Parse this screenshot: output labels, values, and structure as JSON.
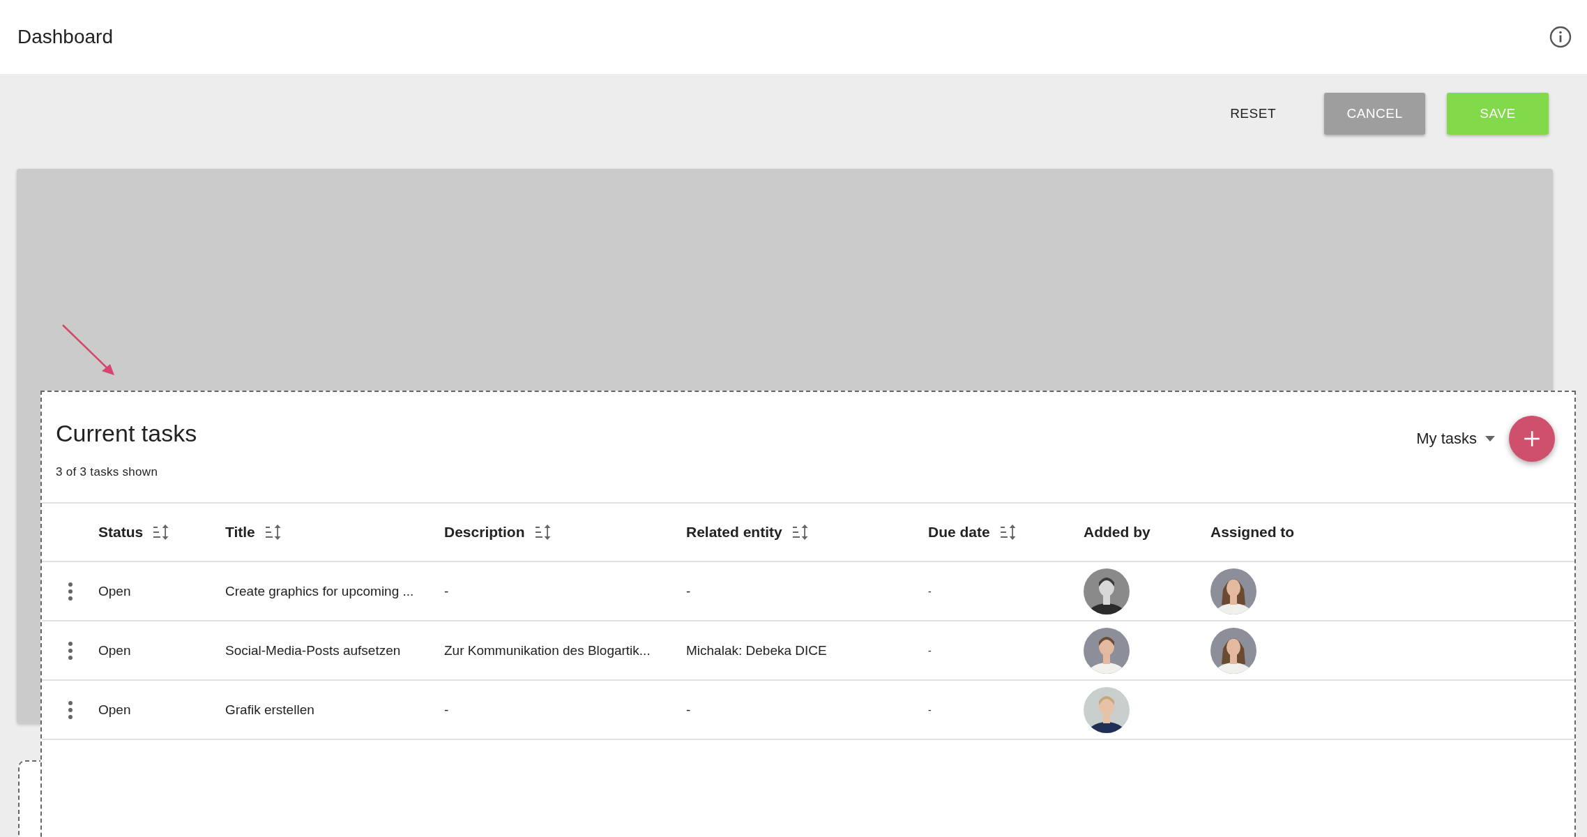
{
  "header": {
    "title": "Dashboard"
  },
  "actions": [
    {
      "label": "RESET",
      "kind": "text"
    },
    {
      "label": "CANCEL",
      "kind": "secondary"
    },
    {
      "label": "SAVE",
      "kind": "primary"
    }
  ],
  "card": {
    "title": "Current tasks",
    "subtitle": "3 of 3 tasks shown",
    "filter": "My tasks",
    "columns": [
      {
        "label": "Status",
        "sortable": true
      },
      {
        "label": "Title",
        "sortable": true
      },
      {
        "label": "Description",
        "sortable": true
      },
      {
        "label": "Related entity",
        "sortable": true
      },
      {
        "label": "Due date",
        "sortable": true
      },
      {
        "label": "Added by",
        "sortable": false
      },
      {
        "label": "Assigned to",
        "sortable": false
      }
    ],
    "rows": [
      {
        "status": "Open",
        "title": "Create graphics for upcoming ...",
        "description": "-",
        "related_entity": "-",
        "due_date": "-"
      },
      {
        "status": "Open",
        "title": "Social-Media-Posts aufsetzen",
        "description": "Zur Kommunikation des Blogartik...",
        "related_entity": "Michalak: Debeka DICE",
        "due_date": "-"
      },
      {
        "status": "Open",
        "title": "Grafik erstellen",
        "description": "-",
        "related_entity": "-",
        "due_date": "-"
      }
    ]
  }
}
